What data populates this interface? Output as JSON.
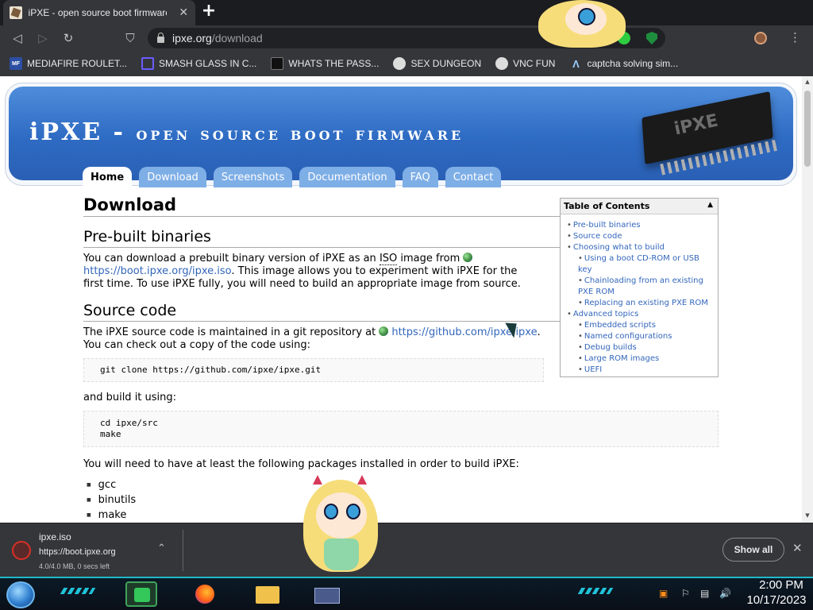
{
  "browser": {
    "tab_title": "iPXE - open source boot firmware",
    "tab_close": "✕",
    "new_tab": "+",
    "url_host": "ipxe.org",
    "url_path": "/download",
    "back_icon": "◁",
    "forward_icon": "▷",
    "reload_icon": "↻",
    "bookmark_icon": "⛉",
    "menu_icon": "⋮",
    "bookmarks": [
      {
        "label": "MEDIAFIRE ROULET...",
        "icon": "MF"
      },
      {
        "label": "SMASH GLASS IN C...",
        "icon": ""
      },
      {
        "label": "WHATS THE PASS...",
        "icon": ""
      },
      {
        "label": "SEX DUNGEON",
        "icon": ""
      },
      {
        "label": "VNC FUN",
        "icon": ""
      },
      {
        "label": "captcha solving sim...",
        "icon": "Λ"
      }
    ]
  },
  "site": {
    "banner_title_big": "iPXE - ",
    "banner_title_small": "open source boot firmware",
    "chip_label": "iPXE",
    "nav": [
      "Home",
      "Download",
      "Screenshots",
      "Documentation",
      "FAQ",
      "Contact"
    ]
  },
  "content": {
    "h1": "Download",
    "prebuilt": {
      "heading": "Pre-built binaries",
      "text1": "You can download a prebuilt binary version of iPXE as an ",
      "abbr": "ISO",
      "text2": " image from",
      "link": "https://boot.ipxe.org/ipxe.iso",
      "text3": ". This image allows you to experiment with iPXE for the first time. To use iPXE fully, you will need to build an appropriate image from source."
    },
    "source": {
      "heading": "Source code",
      "text1": "The iPXE source code is maintained in a git repository at ",
      "link": "https://github.com/ipxe/ipxe",
      "text2": ". You can check out a copy of the code using:",
      "code1": "git clone https://github.com/ipxe/ipxe.git",
      "text3": "and build it using:",
      "code2": "cd ipxe/src\nmake",
      "text4": "You will need to have at least the following packages installed in order to build iPXE:",
      "packages": [
        "gcc",
        "binutils",
        "make"
      ]
    }
  },
  "toc": {
    "title": "Table of Contents",
    "toggle": "▲",
    "items": [
      {
        "label": "Pre-built binaries",
        "sub": false
      },
      {
        "label": "Source code",
        "sub": false
      },
      {
        "label": "Choosing what to build",
        "sub": false
      },
      {
        "label": "Using a boot CD-ROM or USB key",
        "sub": true
      },
      {
        "label": "Chainloading from an existing PXE ROM",
        "sub": true
      },
      {
        "label": "Replacing an existing PXE ROM",
        "sub": true
      },
      {
        "label": "Advanced topics",
        "sub": false
      },
      {
        "label": "Embedded scripts",
        "sub": true
      },
      {
        "label": "Named configurations",
        "sub": true
      },
      {
        "label": "Debug builds",
        "sub": true
      },
      {
        "label": "Large ROM images",
        "sub": true
      },
      {
        "label": "UEFI",
        "sub": true
      }
    ]
  },
  "download": {
    "filename": "ipxe.iso",
    "url": "https://boot.ipxe.org",
    "status": "4.0/4.0 MB, 0 secs left",
    "show_all": "Show all",
    "close": "✕",
    "chevron": "⌃"
  },
  "taskbar": {
    "time": "2:00 PM",
    "date": "10/17/2023"
  }
}
